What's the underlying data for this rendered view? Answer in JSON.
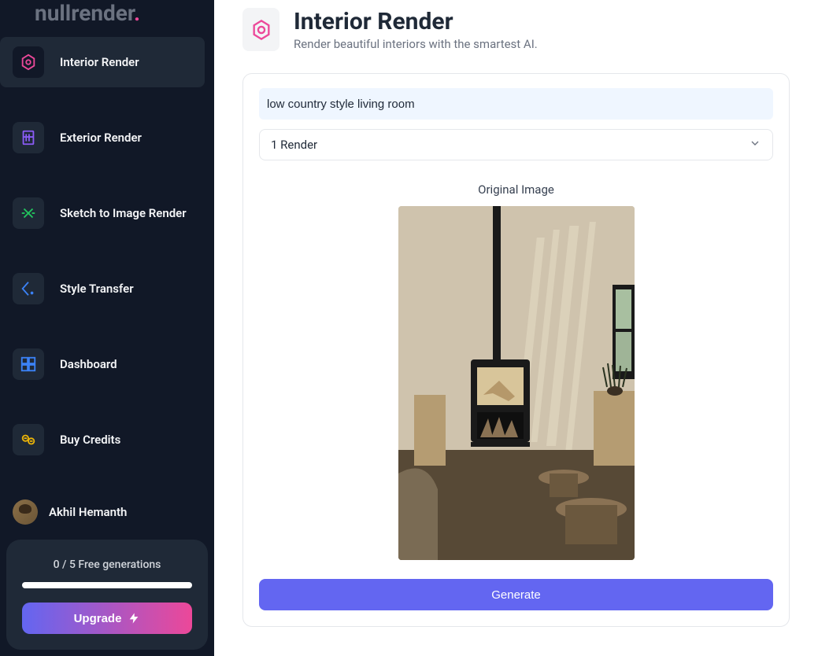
{
  "brand": {
    "name": "nullrender",
    "dot": "."
  },
  "sidebar": {
    "items": [
      {
        "label": "Interior Render",
        "icon": "interior-icon",
        "color": "#ec4899"
      },
      {
        "label": "Exterior Render",
        "icon": "exterior-icon",
        "color": "#8b5cf6"
      },
      {
        "label": "Sketch to Image Render",
        "icon": "sketch-icon",
        "color": "#22c55e"
      },
      {
        "label": "Style Transfer",
        "icon": "style-icon",
        "color": "#3b82f6"
      },
      {
        "label": "Dashboard",
        "icon": "dashboard-icon",
        "color": "#3b82f6"
      },
      {
        "label": "Buy Credits",
        "icon": "credits-icon",
        "color": "#eab308"
      }
    ],
    "user": {
      "name": "Akhil Hemanth"
    }
  },
  "credits": {
    "label": "0 / 5 Free generations",
    "upgrade": "Upgrade"
  },
  "page": {
    "title": "Interior Render",
    "subtitle": "Render beautiful interiors with the smartest AI."
  },
  "form": {
    "prompt": "low country style living room",
    "render_select": "1 Render",
    "original_label": "Original Image",
    "generate": "Generate"
  }
}
